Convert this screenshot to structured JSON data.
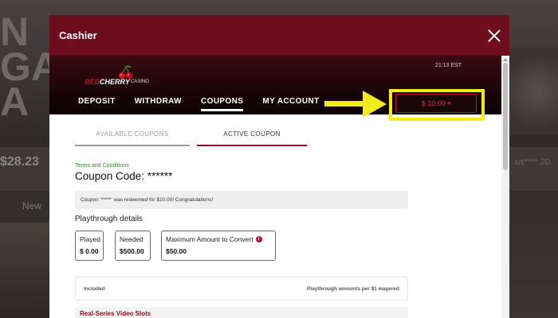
{
  "background": {
    "left_text": "N\nGA\nA",
    "balance": "$28.23",
    "new_label": "New",
    "right_text": "us**** 20"
  },
  "modal": {
    "title": "Cashier",
    "clock": "21:13 EST",
    "logo": {
      "red": "RED",
      "cherry": "CHERRY",
      "casino": "CASINO"
    },
    "nav": [
      {
        "label": "DEPOSIT"
      },
      {
        "label": "WITHDRAW"
      },
      {
        "label": "COUPONS",
        "active": true
      },
      {
        "label": "MY ACCOUNT"
      }
    ],
    "balance_label": "$ 10.00",
    "subtabs": [
      {
        "label": "AVAILABLE COUPONS"
      },
      {
        "label": "ACTIVE COUPON",
        "active": true
      }
    ],
    "terms_link": "Terms and Conditions",
    "coupon_code": "Coupon Code: ******",
    "alert": "Coupon '*****' was redeemed for $10.00! Congratulations!",
    "playthrough_title": "Playthrough details",
    "stats": [
      {
        "label": "Played",
        "value": "$ 0.00"
      },
      {
        "label": "Needed",
        "value": "$500.00"
      },
      {
        "label": "Maximum Amount to Convert",
        "value": "$50.00",
        "info_icon": "info-icon"
      }
    ],
    "included": {
      "left": "Included",
      "right": "Playthrough amounts per $1 wagered"
    },
    "section_title": "Real-Series Video Slots"
  },
  "colors": {
    "header": "#6e0d1e",
    "accent": "#c8102e",
    "highlight": "#f2ea1b",
    "terms_green": "#2a8a2a"
  }
}
